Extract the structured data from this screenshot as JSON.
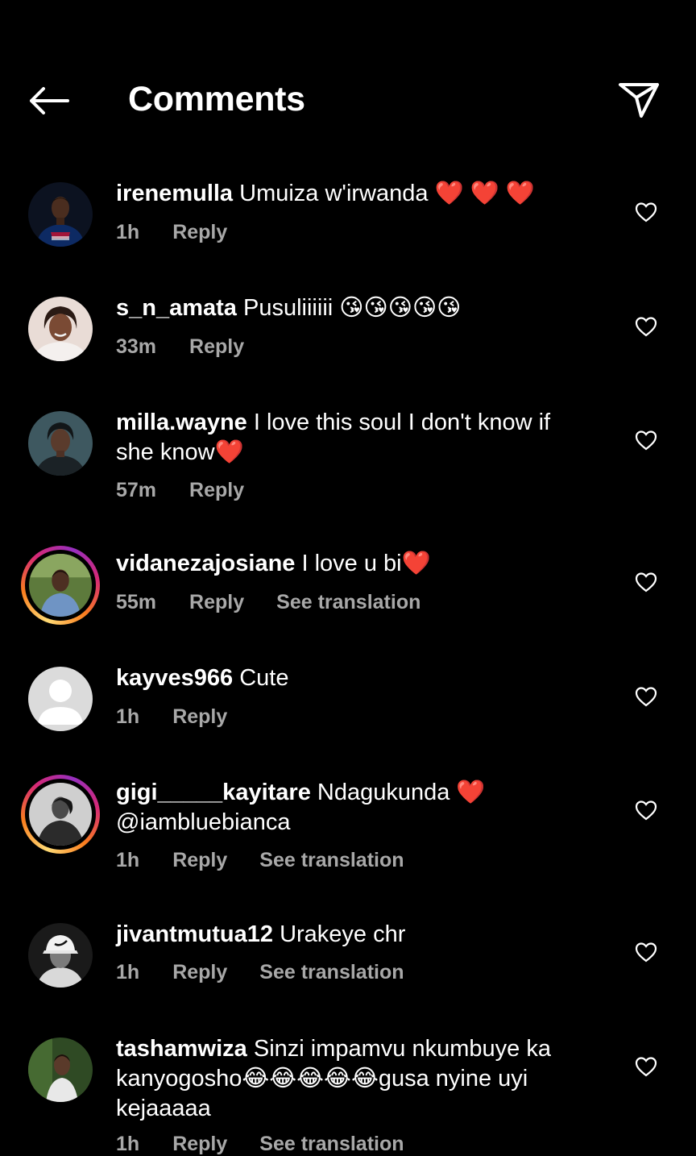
{
  "header": {
    "title": "Comments",
    "back_icon": "arrow-left-icon",
    "share_icon": "paper-plane-icon"
  },
  "labels": {
    "reply": "Reply",
    "see_translation": "See translation"
  },
  "comments": [
    {
      "username": "irenemulla",
      "text": "Umuiza w'irwanda ❤️ ❤️ ❤️",
      "time": "1h",
      "story_ring": false,
      "avatar": "photo-man-jersey"
    },
    {
      "username": "s_n_amata",
      "text": "Pusuliiiiii 😘😘😘😘😘",
      "time": "33m",
      "story_ring": false,
      "avatar": "photo-woman-smiling"
    },
    {
      "username": "milla.wayne",
      "text": "I love this soul I don't know if she know❤️",
      "time": "57m",
      "story_ring": false,
      "avatar": "photo-woman-portrait"
    },
    {
      "username": "vidanezajosiane",
      "text": "I love u bi❤️",
      "time": "55m",
      "story_ring": true,
      "show_translation": true,
      "avatar": "photo-woman-outdoor"
    },
    {
      "username": "kayves966",
      "text": "Cute",
      "time": "1h",
      "story_ring": false,
      "avatar": "default-avatar"
    },
    {
      "username": "gigi_____kayitare",
      "text": "Ndagukunda ❤️ @iambluebianca",
      "time": "1h",
      "story_ring": true,
      "show_translation": true,
      "avatar": "photo-woman-bw"
    },
    {
      "username": "jivantmutua12",
      "text": "Urakeye chr",
      "time": "1h",
      "story_ring": false,
      "show_translation": true,
      "avatar": "photo-man-cap-bw"
    },
    {
      "username": "tashamwiza",
      "text": "Sinzi impamvu nkumbuye ka kanyogosho😂😂😂😂😂gusa nyine uyi kejaaaaa",
      "time": "1h",
      "story_ring": false,
      "show_translation": true,
      "avatar": "photo-woman-garden"
    }
  ],
  "colors": {
    "background": "#000000",
    "text": "#ffffff",
    "secondary_text": "#a8a8a8",
    "story_ring": [
      "#feda75",
      "#fa7e1e",
      "#d62976",
      "#962fbf"
    ]
  }
}
